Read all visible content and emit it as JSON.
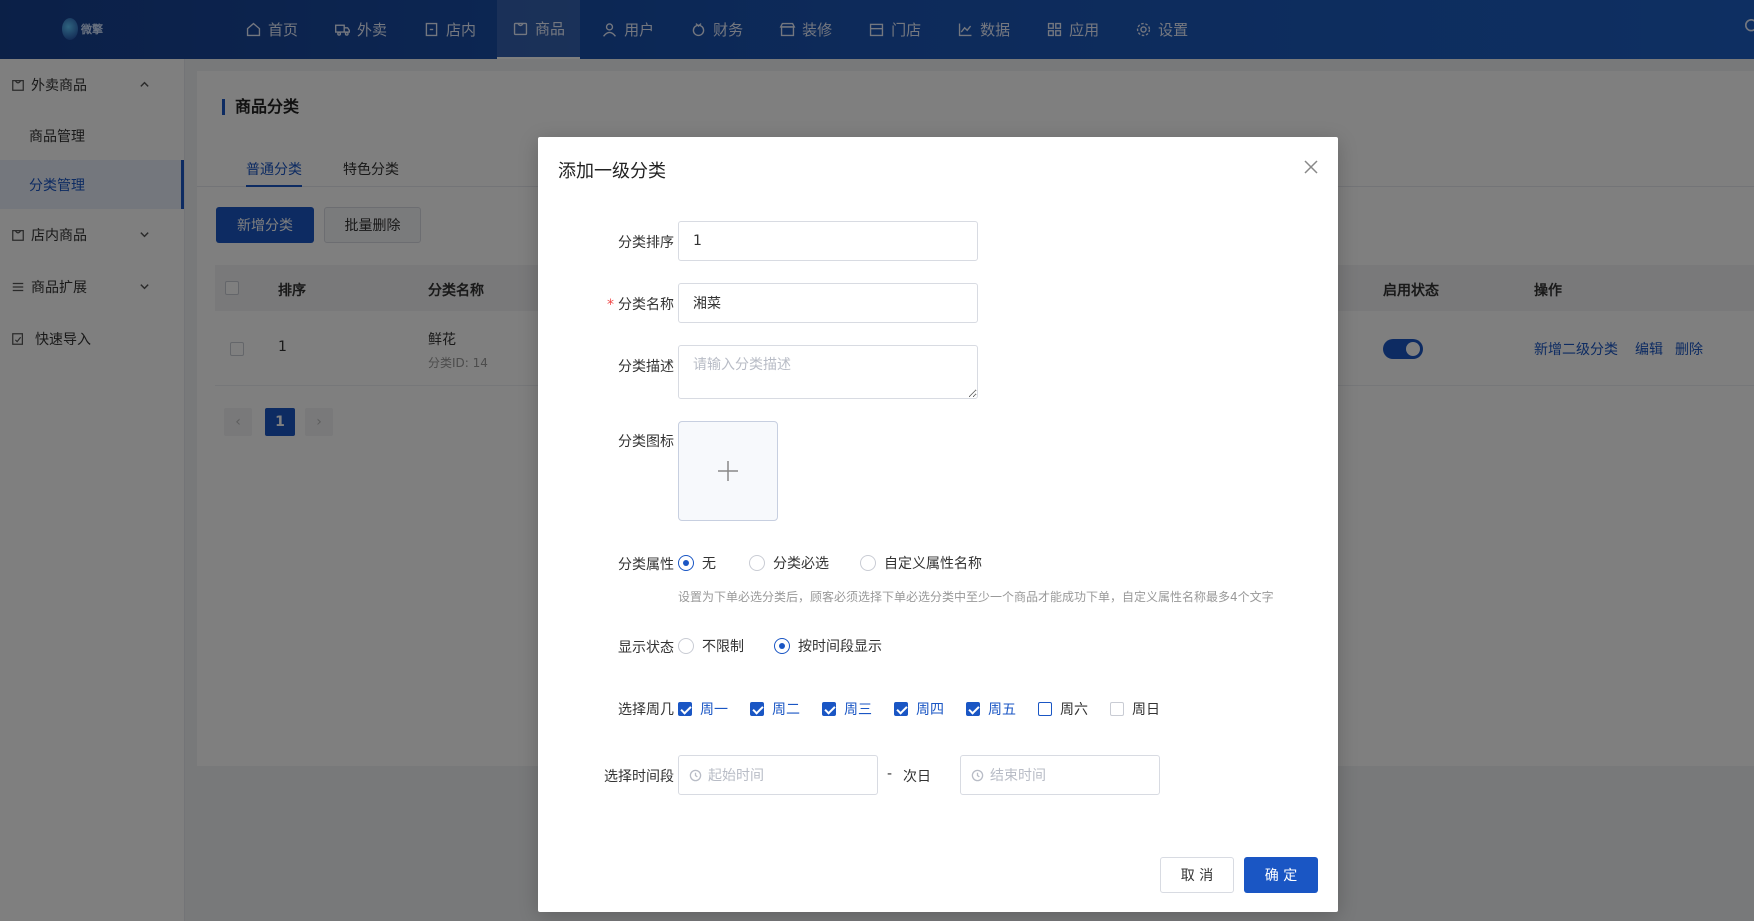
{
  "header": {
    "logo_text": "微擎",
    "nav": [
      {
        "label": "首页",
        "icon": "home-icon"
      },
      {
        "label": "外卖",
        "icon": "delivery-icon"
      },
      {
        "label": "店内",
        "icon": "store-in-icon"
      },
      {
        "label": "商品",
        "icon": "goods-icon",
        "active": true
      },
      {
        "label": "用户",
        "icon": "user-icon"
      },
      {
        "label": "财务",
        "icon": "finance-icon"
      },
      {
        "label": "装修",
        "icon": "decorate-icon"
      },
      {
        "label": "门店",
        "icon": "shop-icon"
      },
      {
        "label": "数据",
        "icon": "chart-icon"
      },
      {
        "label": "应用",
        "icon": "apps-icon"
      },
      {
        "label": "设置",
        "icon": "gear-icon"
      }
    ]
  },
  "sidebar": {
    "groups": [
      {
        "label": "外卖商品",
        "expanded": true,
        "items": [
          "商品管理",
          "分类管理"
        ],
        "active_item": "分类管理"
      },
      {
        "label": "店内商品",
        "expanded": false
      },
      {
        "label": "商品扩展",
        "expanded": false
      },
      {
        "label": "快速导入"
      }
    ]
  },
  "main": {
    "title": "商品分类",
    "tabs": [
      "普通分类",
      "特色分类"
    ],
    "active_tab": "普通分类",
    "add_button": "新增分类",
    "batch_delete_button": "批量删除",
    "table": {
      "headers": {
        "sort": "排序",
        "name": "分类名称",
        "status": "启用状态",
        "actions": "操作"
      },
      "rows": [
        {
          "sort": "1",
          "name": "鲜花",
          "id_text": "分类ID: 14",
          "enabled": true,
          "actions": [
            "新增二级分类",
            "编辑",
            "删除"
          ]
        }
      ]
    },
    "pagination": {
      "current": "1",
      "prev": "‹",
      "next": "›"
    }
  },
  "modal": {
    "title": "添加一级分类",
    "fields": {
      "sort_label": "分类排序",
      "sort_value": "1",
      "name_label": "分类名称",
      "name_value": "湘菜",
      "desc_label": "分类描述",
      "desc_placeholder": "请输入分类描述",
      "icon_label": "分类图标",
      "attr_label": "分类属性",
      "attr_options": [
        "无",
        "分类必选",
        "自定义属性名称"
      ],
      "attr_selected": "无",
      "attr_hint": "设置为下单必选分类后，顾客必须选择下单必选分类中至少一个商品才能成功下单，自定义属性名称最多4个文字",
      "display_label": "显示状态",
      "display_options": [
        "不限制",
        "按时间段显示"
      ],
      "display_selected": "按时间段显示",
      "weekday_label": "选择周几",
      "weekdays": [
        {
          "label": "周一",
          "checked": true
        },
        {
          "label": "周二",
          "checked": true
        },
        {
          "label": "周三",
          "checked": true
        },
        {
          "label": "周四",
          "checked": true
        },
        {
          "label": "周五",
          "checked": true
        },
        {
          "label": "周六",
          "checked": false
        },
        {
          "label": "周日",
          "checked": false
        }
      ],
      "time_label": "选择时间段",
      "start_placeholder": "起始时间",
      "separator": "-",
      "next_day": "次日",
      "end_placeholder": "结束时间"
    },
    "cancel_button": "取 消",
    "confirm_button": "确 定"
  }
}
